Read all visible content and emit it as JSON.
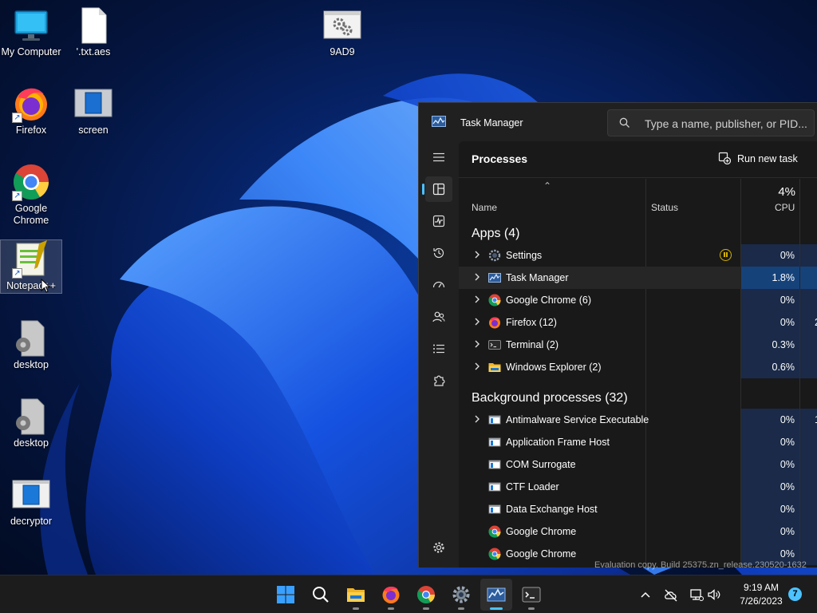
{
  "desktop": {
    "icons": [
      {
        "label": "My Computer",
        "icon": "monitor-icon"
      },
      {
        "label": "'.txt.aes",
        "icon": "file-icon"
      },
      {
        "label": "9AD9",
        "icon": "settings-file-icon"
      },
      {
        "label": "Firefox",
        "icon": "firefox-icon"
      },
      {
        "label": "screen",
        "icon": "screen-icon"
      },
      {
        "label": "Google Chrome",
        "icon": "chrome-icon"
      },
      {
        "label": "Notepad++",
        "icon": "notepadpp-icon"
      },
      {
        "label": "desktop",
        "icon": "gear-file-icon"
      },
      {
        "label": "desktop",
        "icon": "gear-file-icon"
      },
      {
        "label": "decryptor",
        "icon": "decryptor-icon"
      }
    ]
  },
  "task_manager": {
    "title": "Task Manager",
    "search_placeholder": "Type a name, publisher, or PID...",
    "page_title": "Processes",
    "run_new_task": "Run new task",
    "columns": {
      "name": "Name",
      "status": "Status",
      "cpu_total": "4%",
      "cpu": "CPU"
    },
    "groups": [
      {
        "header": "Apps (4)",
        "rows": [
          {
            "name": "Settings",
            "icon": "settings-gear-icon",
            "expandable": true,
            "status": "suspended",
            "cpu": "0%"
          },
          {
            "name": "Task Manager",
            "icon": "task-manager-icon",
            "expandable": true,
            "status": "",
            "cpu": "1.8%"
          },
          {
            "name": "Google Chrome (6)",
            "icon": "chrome-icon",
            "expandable": true,
            "status": "",
            "cpu": "0%"
          },
          {
            "name": "Firefox (12)",
            "icon": "firefox-icon",
            "expandable": true,
            "status": "",
            "cpu": "0%",
            "next": "2"
          },
          {
            "name": "Terminal (2)",
            "icon": "terminal-icon",
            "expandable": true,
            "status": "",
            "cpu": "0.3%"
          },
          {
            "name": "Windows Explorer (2)",
            "icon": "folder-icon",
            "expandable": true,
            "status": "",
            "cpu": "0.6%"
          }
        ]
      },
      {
        "header": "Background processes (32)",
        "rows": [
          {
            "name": "Antimalware Service Executable",
            "icon": "app-window-icon",
            "expandable": true,
            "status": "",
            "cpu": "0%",
            "next": "1"
          },
          {
            "name": "Application Frame Host",
            "icon": "app-window-icon",
            "expandable": false,
            "status": "",
            "cpu": "0%"
          },
          {
            "name": "COM Surrogate",
            "icon": "app-window-icon",
            "expandable": false,
            "status": "",
            "cpu": "0%"
          },
          {
            "name": "CTF Loader",
            "icon": "app-window-icon",
            "expandable": false,
            "status": "",
            "cpu": "0%"
          },
          {
            "name": "Data Exchange Host",
            "icon": "app-window-icon",
            "expandable": false,
            "status": "",
            "cpu": "0%"
          },
          {
            "name": "Google Chrome",
            "icon": "chrome-icon",
            "expandable": false,
            "status": "",
            "cpu": "0%"
          },
          {
            "name": "Google Chrome",
            "icon": "chrome-icon",
            "expandable": false,
            "status": "",
            "cpu": "0%"
          }
        ]
      }
    ]
  },
  "watermark": "Evaluation copy. Build 25375.zn_release.230520-1632",
  "taskbar": {
    "apps": [
      {
        "name": "start",
        "icon": "windows-start-icon"
      },
      {
        "name": "search",
        "icon": "search-icon"
      },
      {
        "name": "file-explorer",
        "icon": "folder-icon"
      },
      {
        "name": "firefox",
        "icon": "firefox-icon"
      },
      {
        "name": "chrome",
        "icon": "chrome-icon"
      },
      {
        "name": "settings",
        "icon": "gear-icon"
      },
      {
        "name": "task-manager",
        "icon": "task-manager-icon"
      },
      {
        "name": "terminal",
        "icon": "terminal-icon"
      }
    ],
    "clock_time": "9:19 AM",
    "clock_date": "7/26/2023",
    "notification_count": "7"
  },
  "colors": {
    "accent": "#4cc2ff",
    "cpu_cell": "#1a2a48",
    "cpu_cell_hot": "#16427a",
    "status_suspended": "#d4b000"
  }
}
